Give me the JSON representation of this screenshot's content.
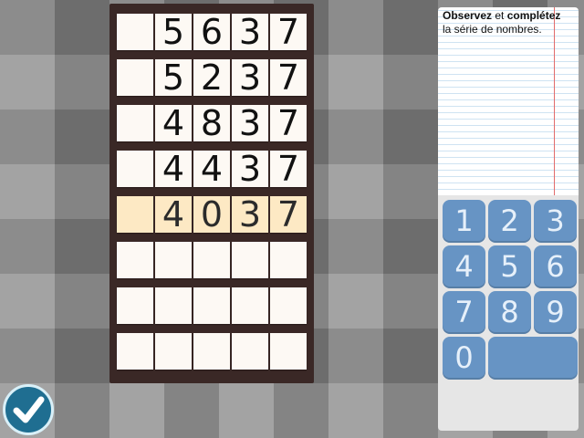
{
  "instructions": {
    "bold_1": "Observez",
    "text_1": " et ",
    "bold_2": "complétez",
    "line_2": "la série de nombres."
  },
  "grid": {
    "rows": [
      [
        "",
        "5",
        "6",
        "3",
        "7"
      ],
      [
        "",
        "5",
        "2",
        "3",
        "7"
      ],
      [
        "",
        "4",
        "8",
        "3",
        "7"
      ],
      [
        "",
        "4",
        "4",
        "3",
        "7"
      ],
      [
        "",
        "4",
        "0",
        "3",
        "7"
      ],
      [
        "",
        "",
        "",
        "",
        ""
      ],
      [
        "",
        "",
        "",
        "",
        ""
      ],
      [
        "",
        "",
        "",
        "",
        ""
      ]
    ],
    "active_row": 5
  },
  "keypad": {
    "keys": [
      "1",
      "2",
      "3",
      "4",
      "5",
      "6",
      "7",
      "8",
      "9",
      "0",
      ""
    ]
  },
  "colors": {
    "board": "#3a2826",
    "cell": "#fdf9f4",
    "active_cell": "#fde9c4",
    "key": "#6794c4",
    "check_button": "#1f6e91"
  },
  "icons": {
    "validate": "checkmark-icon"
  }
}
